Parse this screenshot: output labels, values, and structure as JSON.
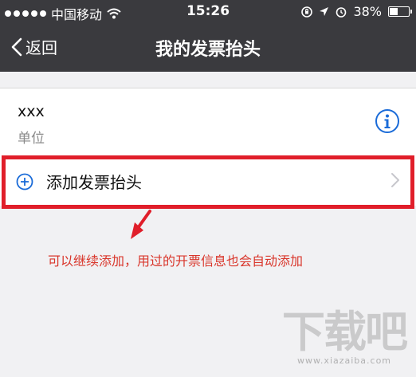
{
  "status_bar": {
    "carrier": "中国移动",
    "time": "15:26",
    "battery": "38%",
    "battery_level": 0.38,
    "icons": [
      "signal-dots-icon",
      "wifi-icon",
      "rotation-lock-icon",
      "location-icon",
      "alarm-icon",
      "battery-icon"
    ]
  },
  "nav": {
    "back_label": "返回",
    "title": "我的发票抬头"
  },
  "invoice_item": {
    "name": "xxx",
    "type": "单位",
    "info_icon": "info-icon"
  },
  "add_row": {
    "label": "添加发票抬头",
    "icon": "plus-circle-icon",
    "chevron_icon": "chevron-right-icon"
  },
  "annotation": {
    "text": "可以继续添加，用过的开票信息也会自动添加"
  },
  "watermark": {
    "logo": "下载吧",
    "url": "www.xiazaiba.com"
  },
  "colors": {
    "nav_bg": "#3a3a3e",
    "page_bg": "#f1f1f3",
    "accent_blue": "#1a6bd8",
    "highlight_red": "#e01e2a",
    "annotation_red": "#d9362b"
  }
}
